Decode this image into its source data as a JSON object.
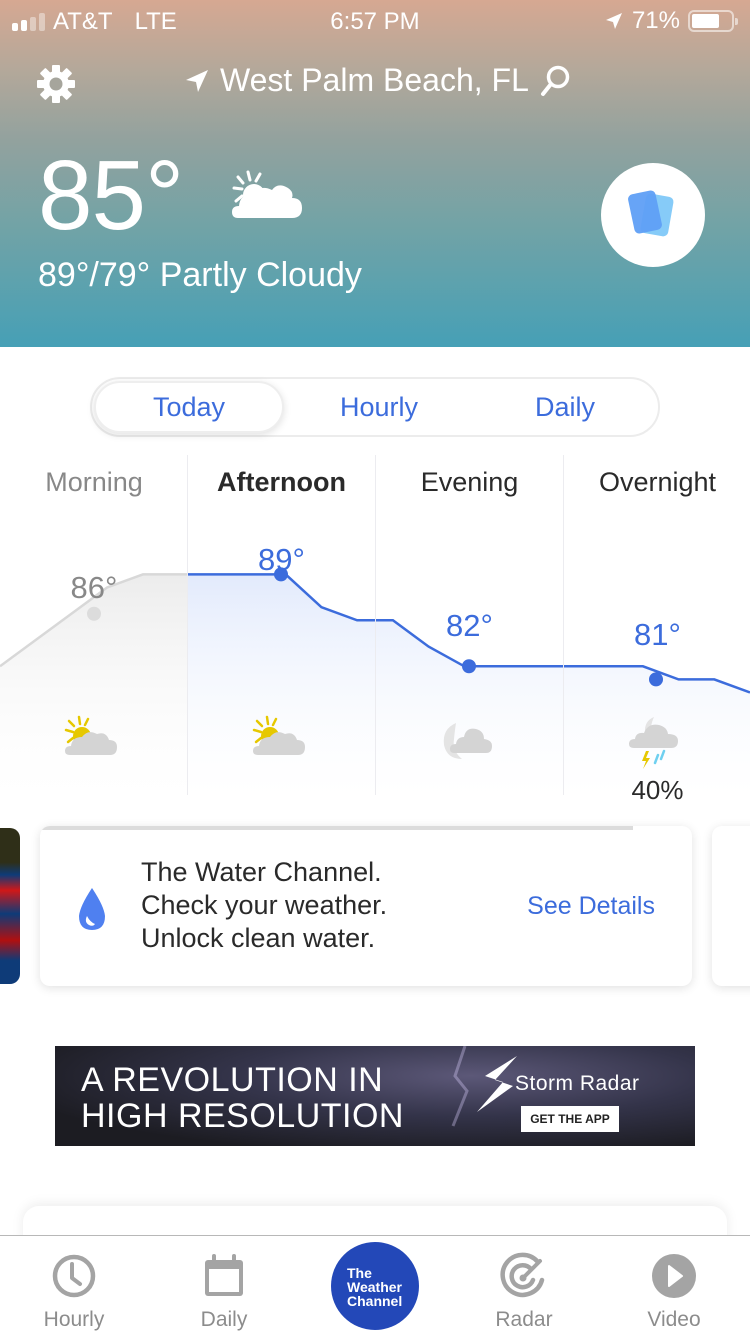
{
  "status_bar": {
    "carrier": "AT&T",
    "network": "LTE",
    "time": "6:57 PM",
    "battery": "71%",
    "battery_level": 0.71,
    "signal_bars_active": 2,
    "signal_bars_total": 4
  },
  "header": {
    "location": "West Palm Beach, FL",
    "current_temp": "85°",
    "high_low_condition": "89°/79° Partly Cloudy",
    "condition_icon": "partly-cloudy-day-icon",
    "settings_icon": "gear-icon",
    "search_icon": "search-icon",
    "location_icon": "location-arrow-icon",
    "cards_icon": "cards-icon"
  },
  "segment": {
    "tabs": [
      {
        "label": "Today",
        "active": true
      },
      {
        "label": "Hourly",
        "active": false
      },
      {
        "label": "Daily",
        "active": false
      }
    ]
  },
  "periods": [
    {
      "label": "Morning",
      "temp": "86°",
      "icon": "partly-cloudy-day-icon",
      "precip": "",
      "state": "past"
    },
    {
      "label": "Afternoon",
      "temp": "89°",
      "icon": "partly-cloudy-day-icon",
      "precip": "",
      "state": "active"
    },
    {
      "label": "Evening",
      "temp": "82°",
      "icon": "partly-cloudy-night-icon",
      "precip": "",
      "state": "future"
    },
    {
      "label": "Overnight",
      "temp": "81°",
      "icon": "thunderstorm-night-icon",
      "precip": "40%",
      "state": "future"
    }
  ],
  "chart_data": {
    "type": "line",
    "title": "",
    "categories": [
      "Morning",
      "Afternoon",
      "Evening",
      "Overnight"
    ],
    "series": [
      {
        "name": "Temperature (°F)",
        "values": [
          86,
          89,
          82,
          81
        ]
      }
    ],
    "trend": [
      82,
      84,
      86,
      88,
      89,
      89,
      89,
      89,
      89,
      86.5,
      85.5,
      85.5,
      83.5,
      82,
      82,
      82,
      82,
      82,
      82,
      81,
      81,
      80
    ],
    "ylim": [
      76,
      92
    ],
    "xlabel": "",
    "ylabel": ""
  },
  "promo": {
    "icon": "water-drop-icon",
    "lines": [
      "The Water Channel.",
      "Check your weather.",
      "Unlock clean water."
    ],
    "action": "See Details",
    "progress": 0.91,
    "accent": "#3c6cdc"
  },
  "ad": {
    "headline_1": "A REVOLUTION IN",
    "headline_2": "HIGH RESOLUTION",
    "brand": "Storm Radar",
    "cta": "GET THE APP"
  },
  "tabbar": {
    "items": [
      {
        "label": "Hourly",
        "icon": "clock-icon"
      },
      {
        "label": "Daily",
        "icon": "calendar-icon"
      },
      {
        "label": "Radar",
        "icon": "radar-icon"
      },
      {
        "label": "Video",
        "icon": "play-icon"
      }
    ],
    "logo": [
      "The",
      "Weather",
      "Channel"
    ],
    "logo_color": "#2348b8"
  }
}
